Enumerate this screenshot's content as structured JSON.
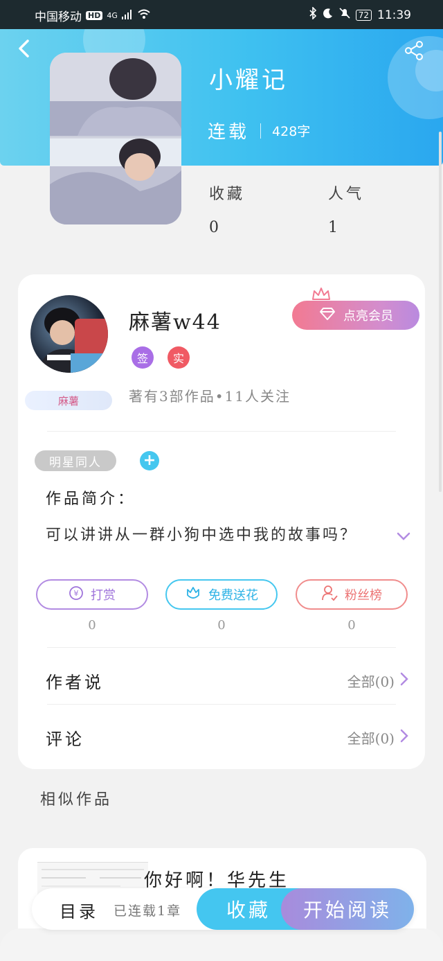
{
  "statusbar": {
    "carrier": "中国移动",
    "hd": "HD",
    "network": "4G",
    "battery": "72",
    "time": "11:39"
  },
  "book": {
    "title": "小耀记",
    "status": "连载",
    "word_count": "428字",
    "favorites_label": "收藏",
    "favorites_value": "0",
    "popularity_label": "人气",
    "popularity_value": "1"
  },
  "author": {
    "name": "麻薯w44",
    "badge_sign": "签",
    "badge_real": "实",
    "name_tag": "麻薯",
    "works_info": "著有3部作品•11人关注",
    "vip_button": "点亮会员"
  },
  "intro": {
    "genre_tag": "明星同人",
    "add_tag": "+",
    "label": "作品简介：",
    "text": "可以讲讲从一群小狗中选中我的故事吗？"
  },
  "actions": [
    {
      "label": "打赏",
      "count": "0",
      "icon": "yen-coin-icon"
    },
    {
      "label": "免费送花",
      "count": "0",
      "icon": "flower-icon"
    },
    {
      "label": "粉丝榜",
      "count": "0",
      "icon": "user-rank-icon"
    }
  ],
  "rows": {
    "author_says": {
      "label": "作者说",
      "right": "全部(0)"
    },
    "comments": {
      "label": "评论",
      "right": "全部(0)"
    }
  },
  "similar": {
    "section_label": "相似作品",
    "items": [
      {
        "title": "你好啊！华先生"
      }
    ]
  },
  "bottom_bar": {
    "toc": "目录",
    "chapters": "已连载1章",
    "favorite": "收藏",
    "start_reading": "开始阅读"
  },
  "colors": {
    "header": "#3fc1f0",
    "accent_blue": "#44c6f0",
    "accent_purple": "#a96ee6",
    "accent_red": "#f05a64"
  }
}
